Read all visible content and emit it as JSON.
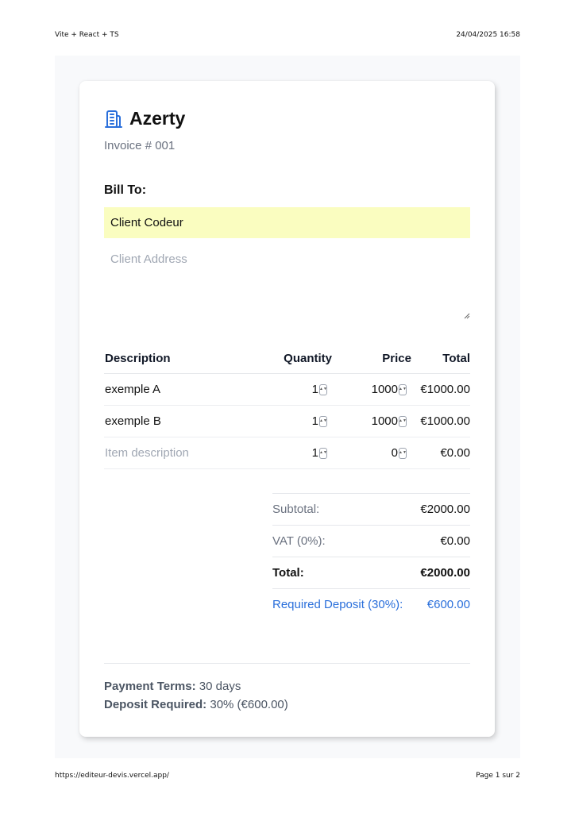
{
  "print": {
    "title": "Vite + React + TS",
    "datetime": "24/04/2025 16:58",
    "url": "https://editeur-devis.vercel.app/",
    "page": "Page 1 sur 2"
  },
  "company": {
    "name": "Azerty",
    "icon": "building-icon",
    "invoice_label": "Invoice # 001"
  },
  "bill_to": {
    "label": "Bill To:",
    "client_name": "Client Codeur",
    "address_placeholder": "Client Address"
  },
  "items": {
    "headers": [
      "Description",
      "Quantity",
      "Price",
      "Total"
    ],
    "rows": [
      {
        "description": "exemple A",
        "quantity": "1",
        "price": "1000",
        "total": "€1000.00"
      },
      {
        "description": "exemple B",
        "quantity": "1",
        "price": "1000",
        "total": "€1000.00"
      },
      {
        "description_placeholder": "Item description",
        "quantity": "1",
        "price": "0",
        "total": "€0.00"
      }
    ]
  },
  "totals": {
    "subtotal_label": "Subtotal:",
    "subtotal": "€2000.00",
    "vat_label": "VAT (0%):",
    "vat": "€0.00",
    "total_label": "Total:",
    "total": "€2000.00",
    "deposit_label": "Required Deposit (30%):",
    "deposit": "€600.00"
  },
  "terms": {
    "payment_label": "Payment Terms:",
    "payment_value": " 30 days",
    "deposit_label": "Deposit Required:",
    "deposit_value": " 30% (€600.00)"
  },
  "colors": {
    "accent": "#2a6fdb",
    "client_highlight": "#fafdc0",
    "muted_text": "#6b7280"
  }
}
